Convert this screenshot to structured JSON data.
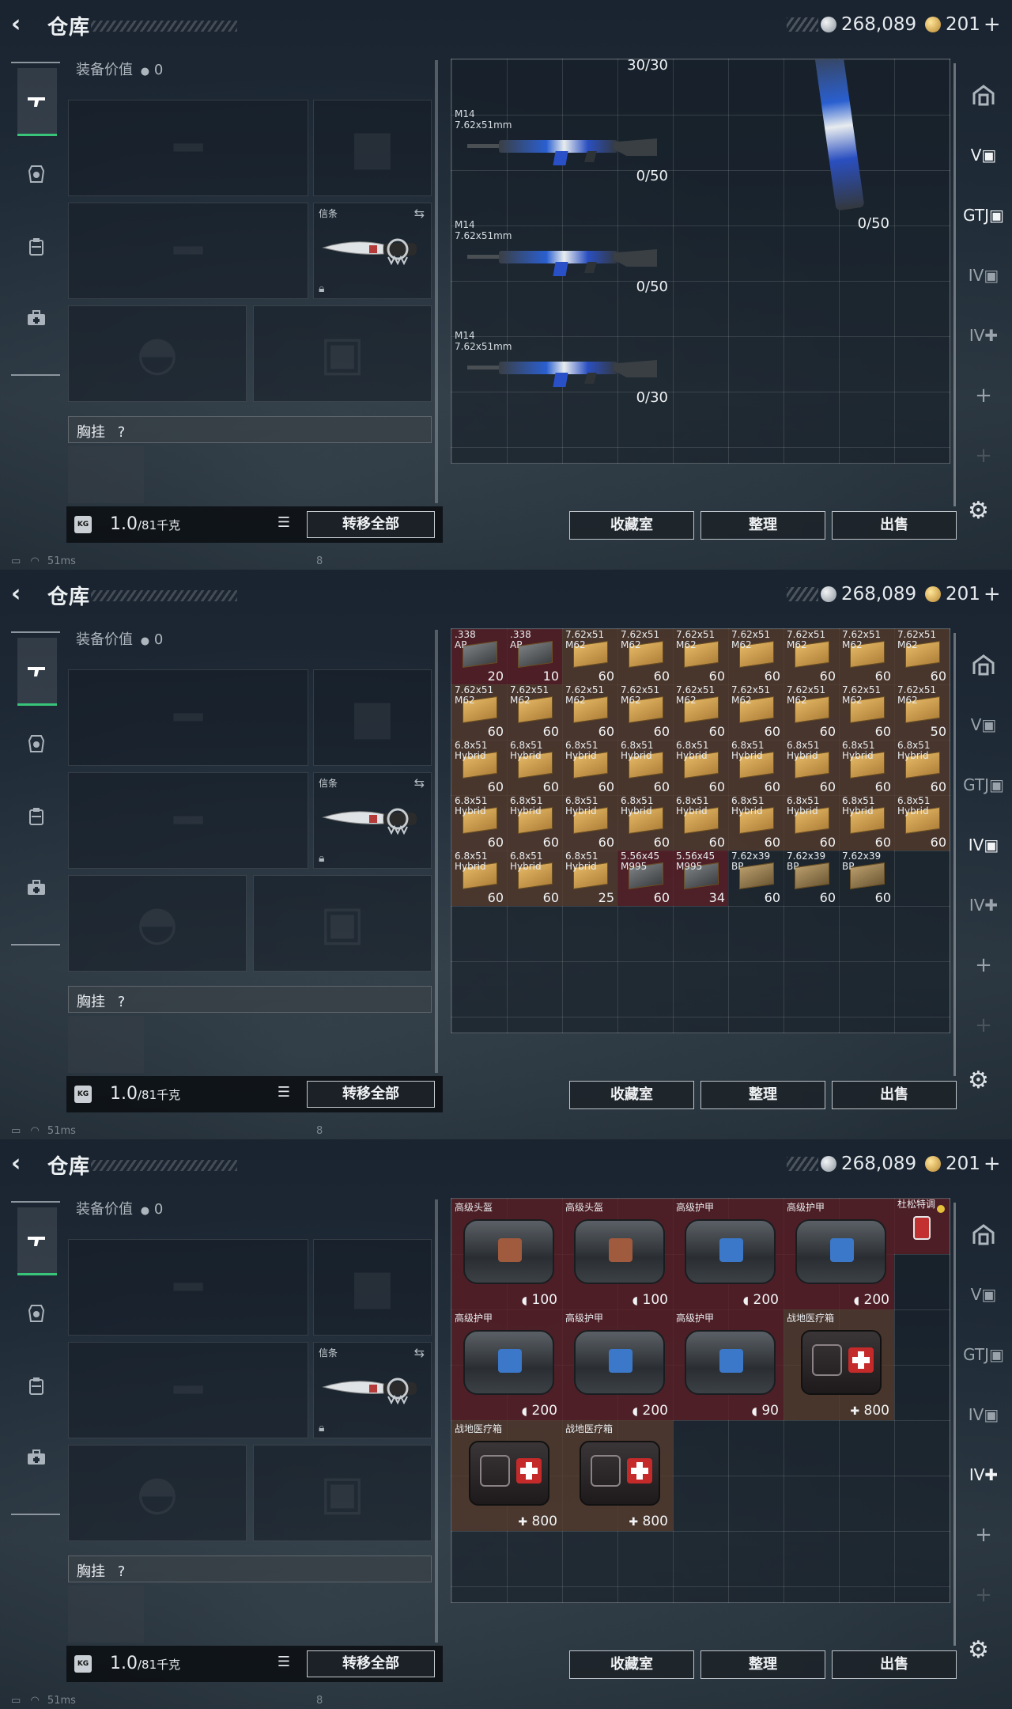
{
  "header": {
    "title": "仓库",
    "currency_silver": "268,089",
    "currency_gold": "201",
    "currency_plus": "+"
  },
  "left": {
    "equip_value_label": "装备价值",
    "equip_value": "0",
    "knife_label": "信条",
    "chest_label": "胸挂",
    "chest_help": "?",
    "kg_icon": "KG",
    "weight_value": "1.0",
    "weight_max": "/81千克",
    "transfer_all": "转移全部"
  },
  "actions": {
    "collection": "收藏室",
    "sort": "整理",
    "sell": "出售"
  },
  "status": {
    "ping": "51ms",
    "num": "8"
  },
  "panel1": {
    "weapons": [
      {
        "label": "",
        "count": "30/30"
      },
      {
        "label": "M14\n7.62x51mm",
        "count": "0/50"
      },
      {
        "label": "M14\n7.62x51mm",
        "count": "0/50"
      },
      {
        "label": "M14\n7.62x51mm",
        "count": "0/30"
      }
    ],
    "vertical_weapon_count": "0/50"
  },
  "panel2": {
    "ammo": [
      {
        "label": ".338\nAP",
        "qty": "20",
        "type": "red"
      },
      {
        "label": ".338\nAP",
        "qty": "10",
        "type": "red"
      },
      {
        "label": "7.62x51\nM62",
        "qty": "60",
        "type": "brown"
      },
      {
        "label": "7.62x51\nM62",
        "qty": "60",
        "type": "brown"
      },
      {
        "label": "7.62x51\nM62",
        "qty": "60",
        "type": "brown"
      },
      {
        "label": "7.62x51\nM62",
        "qty": "60",
        "type": "brown"
      },
      {
        "label": "7.62x51\nM62",
        "qty": "60",
        "type": "brown"
      },
      {
        "label": "7.62x51\nM62",
        "qty": "60",
        "type": "brown"
      },
      {
        "label": "7.62x51\nM62",
        "qty": "60",
        "type": "brown"
      },
      {
        "label": "7.62x51\nM62",
        "qty": "60",
        "type": "brown"
      },
      {
        "label": "7.62x51\nM62",
        "qty": "60",
        "type": "brown"
      },
      {
        "label": "7.62x51\nM62",
        "qty": "60",
        "type": "brown"
      },
      {
        "label": "7.62x51\nM62",
        "qty": "60",
        "type": "brown"
      },
      {
        "label": "7.62x51\nM62",
        "qty": "60",
        "type": "brown"
      },
      {
        "label": "7.62x51\nM62",
        "qty": "60",
        "type": "brown"
      },
      {
        "label": "7.62x51\nM62",
        "qty": "60",
        "type": "brown"
      },
      {
        "label": "7.62x51\nM62",
        "qty": "60",
        "type": "brown"
      },
      {
        "label": "7.62x51\nM62",
        "qty": "50",
        "type": "brown"
      },
      {
        "label": "6.8x51\nHybrid",
        "qty": "60",
        "type": "brown"
      },
      {
        "label": "6.8x51\nHybrid",
        "qty": "60",
        "type": "brown"
      },
      {
        "label": "6.8x51\nHybrid",
        "qty": "60",
        "type": "brown"
      },
      {
        "label": "6.8x51\nHybrid",
        "qty": "60",
        "type": "brown"
      },
      {
        "label": "6.8x51\nHybrid",
        "qty": "60",
        "type": "brown"
      },
      {
        "label": "6.8x51\nHybrid",
        "qty": "60",
        "type": "brown"
      },
      {
        "label": "6.8x51\nHybrid",
        "qty": "60",
        "type": "brown"
      },
      {
        "label": "6.8x51\nHybrid",
        "qty": "60",
        "type": "brown"
      },
      {
        "label": "6.8x51\nHybrid",
        "qty": "60",
        "type": "brown"
      },
      {
        "label": "6.8x51\nHybrid",
        "qty": "60",
        "type": "brown"
      },
      {
        "label": "6.8x51\nHybrid",
        "qty": "60",
        "type": "brown"
      },
      {
        "label": "6.8x51\nHybrid",
        "qty": "60",
        "type": "brown"
      },
      {
        "label": "6.8x51\nHybrid",
        "qty": "60",
        "type": "brown"
      },
      {
        "label": "6.8x51\nHybrid",
        "qty": "60",
        "type": "brown"
      },
      {
        "label": "6.8x51\nHybrid",
        "qty": "60",
        "type": "brown"
      },
      {
        "label": "6.8x51\nHybrid",
        "qty": "60",
        "type": "brown"
      },
      {
        "label": "6.8x51\nHybrid",
        "qty": "60",
        "type": "brown"
      },
      {
        "label": "6.8x51\nHybrid",
        "qty": "60",
        "type": "brown"
      },
      {
        "label": "6.8x51\nHybrid",
        "qty": "60",
        "type": "brown"
      },
      {
        "label": "6.8x51\nHybrid",
        "qty": "60",
        "type": "brown"
      },
      {
        "label": "6.8x51\nHybrid",
        "qty": "25",
        "type": "brown"
      },
      {
        "label": "5.56x45\nM995",
        "qty": "60",
        "type": "red"
      },
      {
        "label": "5.56x45\nM995",
        "qty": "34",
        "type": "red"
      },
      {
        "label": "7.62x39\nBP",
        "qty": "60",
        "type": "dark"
      },
      {
        "label": "7.62x39\nBP",
        "qty": "60",
        "type": "dark"
      },
      {
        "label": "7.62x39\nBP",
        "qty": "60",
        "type": "dark"
      }
    ]
  },
  "panel3": {
    "items": [
      {
        "label": "高级头盔",
        "qty": "100",
        "kind": "bag",
        "icon": "shield",
        "patch": "#a05a3e",
        "bg": "red"
      },
      {
        "label": "高级头盔",
        "qty": "100",
        "kind": "bag",
        "icon": "shield",
        "patch": "#a05a3e",
        "bg": "red"
      },
      {
        "label": "高级护甲",
        "qty": "200",
        "kind": "bag",
        "icon": "shield",
        "patch": "#3b78c9",
        "bg": "red"
      },
      {
        "label": "高级护甲",
        "qty": "200",
        "kind": "bag",
        "icon": "shield",
        "patch": "#3b78c9",
        "bg": "red"
      },
      {
        "label": "高级护甲",
        "qty": "200",
        "kind": "bag",
        "icon": "shield",
        "patch": "#3b78c9",
        "bg": "red"
      },
      {
        "label": "高级护甲",
        "qty": "200",
        "kind": "bag",
        "icon": "shield",
        "patch": "#3b78c9",
        "bg": "red"
      },
      {
        "label": "高级护甲",
        "qty": "90",
        "kind": "bag",
        "icon": "shield",
        "patch": "#3b78c9",
        "bg": "red"
      },
      {
        "label": "战地医疗箱",
        "qty": "800",
        "kind": "med",
        "icon": "plus",
        "bg": "brown"
      },
      {
        "label": "战地医疗箱",
        "qty": "800",
        "kind": "med",
        "icon": "plus",
        "bg": "brown"
      },
      {
        "label": "战地医疗箱",
        "qty": "800",
        "kind": "med",
        "icon": "plus",
        "bg": "brown"
      }
    ],
    "small_item_label": "杜松特调"
  }
}
